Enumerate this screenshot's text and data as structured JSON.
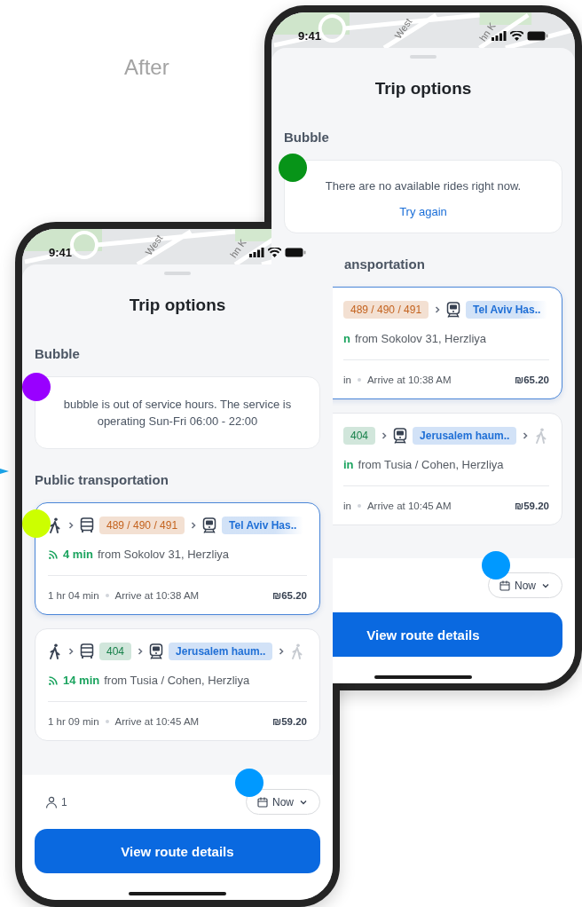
{
  "heading": "After",
  "phones": [
    {
      "time": "9:41",
      "map_labels": [
        "West",
        "hn K"
      ],
      "title": "Trip options",
      "bubble_title": "Bubble",
      "notice": {
        "kind": "unavailable",
        "message": "There are no available rides right now.",
        "action": "Try again"
      },
      "transport_title": "ansportation",
      "covered": true,
      "options": [
        {
          "selected": true,
          "legs": [
            {
              "kind": "line",
              "label": "489 / 490 / 491",
              "color": "#c4631f",
              "faded": false
            },
            {
              "kind": "train",
              "label": "Tel Aviv Has..",
              "color": "#1f6fd6",
              "faded": true
            }
          ],
          "wait": "n",
          "from": "from Sokolov 31, Herzliya",
          "duration": "in",
          "arrival": "Arrive at 10:38 AM",
          "price": "₪65.20"
        },
        {
          "selected": false,
          "legs": [
            {
              "kind": "line",
              "label": "404",
              "color": "#17804a",
              "faded": false
            },
            {
              "kind": "train",
              "label": "Jerusalem haum..",
              "color": "#1f6fd6",
              "faded": false
            },
            {
              "kind": "walk",
              "faded": true
            }
          ],
          "wait": "in",
          "from": "from Tusia / Cohen, Herzliya",
          "duration": "in",
          "arrival": "Arrive at 10:45 AM",
          "price": "₪59.20"
        }
      ],
      "when": "Now",
      "button": "View route details"
    },
    {
      "time": "9:41",
      "map_labels": [
        "West",
        "hn K"
      ],
      "title": "Trip options",
      "bubble_title": "Bubble",
      "notice": {
        "kind": "out_of_hours",
        "message": "bubble is out of service hours. The service is operating Sun-Fri 06:00 - 22:00"
      },
      "transport_title": "Public transportation",
      "covered": false,
      "options": [
        {
          "selected": true,
          "legs": [
            {
              "kind": "walk",
              "faded": false
            },
            {
              "kind": "bus",
              "label": "489 / 490 / 491",
              "color": "#c4631f",
              "faded": false
            },
            {
              "kind": "train",
              "label": "Tel Aviv Has..",
              "color": "#1f6fd6",
              "faded": true
            }
          ],
          "wait": "4 min",
          "from": "from Sokolov 31, Herzliya",
          "duration": "1 hr 04 min",
          "arrival": "Arrive at 10:38 AM",
          "price": "₪65.20"
        },
        {
          "selected": false,
          "legs": [
            {
              "kind": "walk",
              "faded": false
            },
            {
              "kind": "bus",
              "label": "404",
              "color": "#17804a",
              "faded": false
            },
            {
              "kind": "train",
              "label": "Jerusalem haum..",
              "color": "#1f6fd6",
              "faded": false
            },
            {
              "kind": "walk",
              "faded": true
            }
          ],
          "wait": "14 min",
          "from": "from Tusia / Cohen, Herzliya",
          "duration": "1 hr 09 min",
          "arrival": "Arrive at 10:45 AM",
          "price": "₪59.20"
        }
      ],
      "passengers": "1",
      "when": "Now",
      "button": "View route details"
    }
  ],
  "markers": [
    {
      "color": "#079418"
    },
    {
      "color": "#0099ff"
    },
    {
      "color": "#9900ff"
    },
    {
      "color": "#ccff00"
    },
    {
      "color": "#0099ff"
    }
  ]
}
